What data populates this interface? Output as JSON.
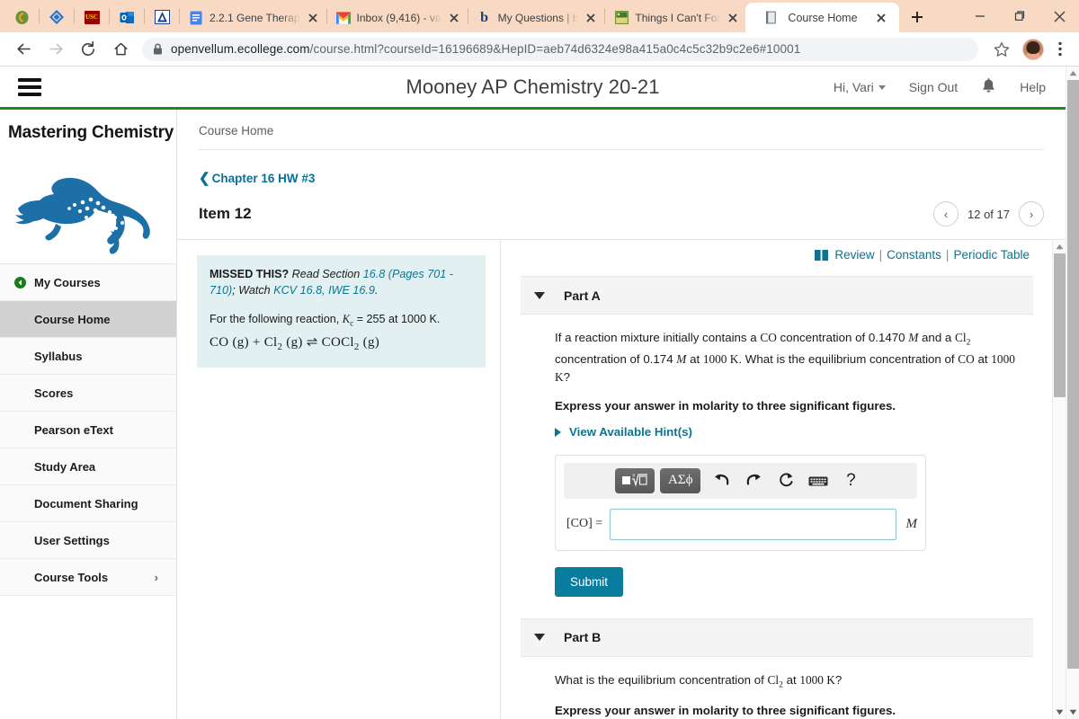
{
  "browser": {
    "pinned_tabs": [
      {
        "name": "pinned-tab-moodle",
        "icon": "moodle-icon"
      },
      {
        "name": "pinned-tab-diamond",
        "icon": "diamond-icon"
      },
      {
        "name": "pinned-tab-usc",
        "icon": "usc-icon",
        "label": "USC"
      },
      {
        "name": "pinned-tab-outlook",
        "icon": "outlook-icon"
      },
      {
        "name": "pinned-tab-ascend",
        "icon": "letter-a-icon"
      }
    ],
    "tabs": [
      {
        "title": "2.2.1 Gene Therap",
        "icon": "google-docs-icon",
        "active": false
      },
      {
        "title": "Inbox (9,416) - va",
        "icon": "gmail-icon",
        "active": false
      },
      {
        "title": "My Questions | b",
        "icon": "bartleby-b-icon",
        "active": false
      },
      {
        "title": "Things I Can't For",
        "icon": "photo-icon",
        "active": false
      },
      {
        "title": "Course Home",
        "icon": "book-tab-icon",
        "active": true
      }
    ],
    "new_tab_label": "+",
    "window_controls": {
      "minimize": "–",
      "maximize": "❐",
      "close": "✕"
    },
    "nav": {
      "back": "back-arrow-icon",
      "forward": "forward-arrow-icon",
      "reload": "reload-icon",
      "home": "home-icon"
    },
    "omnibox": {
      "lock": "lock-icon",
      "host": "openvellum.ecollege.com",
      "path": "/course.html?courseId=16196689&HepID=aeb74d6324e98a415a0c4c5c32b9c2e6#10001",
      "full_url": "openvellum.ecollege.com/course.html?courseId=16196689&HepID=aeb74d6324e98a415a0c4c5c32b9c2e6#10001"
    },
    "bookmark_icon": "star-icon",
    "profile": "avatar",
    "menu_icon": "kebab-menu-icon"
  },
  "app_header": {
    "menu_icon": "hamburger-icon",
    "title": "Mooney AP Chemistry 20-21",
    "greeting": "Hi, Vari",
    "sign_out": "Sign Out",
    "notifications_icon": "bell-icon",
    "help": "Help",
    "accent_color": "#1d8a1d"
  },
  "sidebar": {
    "brand": "Mastering Chemistry",
    "logo": "leaping-cheetah-logo",
    "items": [
      {
        "label": "My Courses",
        "icon": "back-circle-icon",
        "active": false
      },
      {
        "label": "Course Home",
        "icon": "",
        "active": true
      },
      {
        "label": "Syllabus",
        "icon": "",
        "active": false
      },
      {
        "label": "Scores",
        "icon": "",
        "active": false
      },
      {
        "label": "Pearson eText",
        "icon": "",
        "active": false
      },
      {
        "label": "Study Area",
        "icon": "",
        "active": false
      },
      {
        "label": "Document Sharing",
        "icon": "",
        "active": false
      },
      {
        "label": "User Settings",
        "icon": "",
        "active": false
      },
      {
        "label": "Course Tools",
        "icon": "",
        "active": false,
        "chevron": "›"
      }
    ]
  },
  "content": {
    "breadcrumb": "Course Home",
    "back_link": "Chapter 16 HW #3",
    "item_title": "Item 12",
    "pager": {
      "prev": "‹",
      "next": "›",
      "label": "12 of 17"
    },
    "missed": {
      "heading": "MISSED THIS?",
      "read_label": "Read Section",
      "section_link": "16.8 (Pages 701 - 710)",
      "watch_label": "; Watch",
      "watch_link": "KCV 16.8, IWE 16.9",
      "period": ".",
      "reaction_intro": "For the following reaction,",
      "kc_symbol": "K",
      "kc_sub": "c",
      "kc_value": "= 255 at 1000 K.",
      "equation_left": "CO (g) + Cl",
      "equation_left_sub": "2",
      "equation_mid": "(g)",
      "equation_arrow": "⇌",
      "equation_right": "COCl",
      "equation_right_sub": "2",
      "equation_right_tail": "(g)"
    },
    "toolbar_links": {
      "book_icon": "book-icon",
      "review": "Review",
      "constants": "Constants",
      "periodic_table": "Periodic Table",
      "separator": "|"
    },
    "parts": [
      {
        "label": "Part A",
        "question_lines": [
          "If a reaction mixture initially contains a CO concentration of 0.1470 M and a Cl2",
          "concentration of 0.174 M at 1000 K. What is the equilibrium concentration of",
          "CO at 1000 K?"
        ],
        "instruction": "Express your answer in molarity to three significant figures.",
        "hint_link": "View Available Hint(s)",
        "answer": {
          "label": "[CO] =",
          "value": "",
          "placeholder": "",
          "unit": "M"
        },
        "math_toolbar": {
          "template_button": "template-icon",
          "greek_button": "ΑΣϕ",
          "undo": "undo-icon",
          "redo": "redo-icon",
          "reset": "reset-icon",
          "keyboard": "keyboard-icon",
          "help": "?"
        },
        "submit_label": "Submit"
      },
      {
        "label": "Part B",
        "question_lines": [
          "What is the equilibrium concentration of Cl2 at 1000 K?"
        ],
        "instruction": "Express your answer in molarity to three significant figures."
      }
    ]
  },
  "question_values": {
    "co_initial": "0.1470",
    "cl2_initial": "0.174",
    "temperature": "1000 K",
    "kc": "255"
  }
}
